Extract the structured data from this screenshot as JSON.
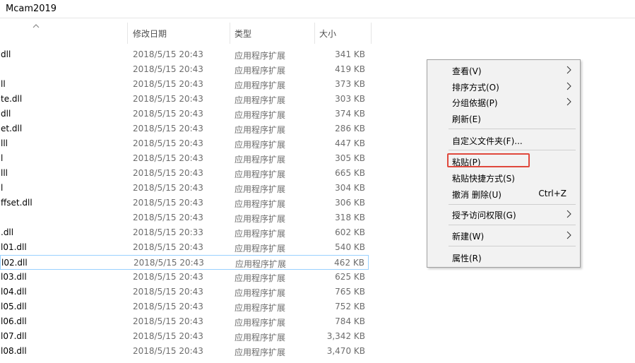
{
  "window": {
    "title": "Mcam2019"
  },
  "columns": {
    "name_sort_icon": "chevron-up",
    "date": "修改日期",
    "type": "类型",
    "size": "大小"
  },
  "files": [
    {
      "name": "dll",
      "date": "2018/5/15 20:43",
      "type": "应用程序扩展",
      "size": "341 KB"
    },
    {
      "name": "",
      "date": "2018/5/15 20:43",
      "type": "应用程序扩展",
      "size": "419 KB"
    },
    {
      "name": "ll",
      "date": "2018/5/15 20:43",
      "type": "应用程序扩展",
      "size": "373 KB"
    },
    {
      "name": "te.dll",
      "date": "2018/5/15 20:43",
      "type": "应用程序扩展",
      "size": "303 KB"
    },
    {
      "name": "dll",
      "date": "2018/5/15 20:43",
      "type": "应用程序扩展",
      "size": "374 KB"
    },
    {
      "name": "et.dll",
      "date": "2018/5/15 20:43",
      "type": "应用程序扩展",
      "size": "286 KB"
    },
    {
      "name": "lll",
      "date": "2018/5/15 20:43",
      "type": "应用程序扩展",
      "size": "447 KB"
    },
    {
      "name": "l",
      "date": "2018/5/15 20:43",
      "type": "应用程序扩展",
      "size": "305 KB"
    },
    {
      "name": "lll",
      "date": "2018/5/15 20:43",
      "type": "应用程序扩展",
      "size": "665 KB"
    },
    {
      "name": "l",
      "date": "2018/5/15 20:43",
      "type": "应用程序扩展",
      "size": "304 KB"
    },
    {
      "name": "ffset.dll",
      "date": "2018/5/15 20:43",
      "type": "应用程序扩展",
      "size": "306 KB"
    },
    {
      "name": "",
      "date": "2018/5/15 20:43",
      "type": "应用程序扩展",
      "size": "318 KB"
    },
    {
      "name": ".dll",
      "date": "2018/5/15 20:33",
      "type": "应用程序扩展",
      "size": "602 KB"
    },
    {
      "name": "l01.dll",
      "date": "2018/5/15 20:43",
      "type": "应用程序扩展",
      "size": "540 KB"
    },
    {
      "name": "l02.dll",
      "date": "2018/5/15 20:43",
      "type": "应用程序扩展",
      "size": "462 KB",
      "selected": true
    },
    {
      "name": "l03.dll",
      "date": "2018/5/15 20:43",
      "type": "应用程序扩展",
      "size": "625 KB"
    },
    {
      "name": "l04.dll",
      "date": "2018/5/15 20:43",
      "type": "应用程序扩展",
      "size": "765 KB"
    },
    {
      "name": "l05.dll",
      "date": "2018/5/15 20:43",
      "type": "应用程序扩展",
      "size": "752 KB"
    },
    {
      "name": "l06.dll",
      "date": "2018/5/15 20:43",
      "type": "应用程序扩展",
      "size": "784 KB"
    },
    {
      "name": "l07.dll",
      "date": "2018/5/15 20:43",
      "type": "应用程序扩展",
      "size": "3,342 KB"
    },
    {
      "name": "l08.dll",
      "date": "2018/5/15 20:43",
      "type": "应用程序扩展",
      "size": "3,470 KB"
    }
  ],
  "context_menu": {
    "items": [
      {
        "label": "查看(V)",
        "submenu": true
      },
      {
        "label": "排序方式(O)",
        "submenu": true
      },
      {
        "label": "分组依据(P)",
        "submenu": true
      },
      {
        "label": "刷新(E)",
        "submenu": false
      },
      {
        "label": "自定义文件夹(F)...",
        "submenu": false
      },
      {
        "label": "粘贴(P)",
        "submenu": false,
        "highlighted": true
      },
      {
        "label": "粘贴快捷方式(S)",
        "submenu": false
      },
      {
        "label": "撤消 删除(U)",
        "shortcut": "Ctrl+Z",
        "submenu": false
      },
      {
        "label": "授予访问权限(G)",
        "submenu": true
      },
      {
        "label": "新建(W)",
        "submenu": true
      },
      {
        "label": "属性(R)",
        "submenu": false
      }
    ],
    "highlight_color": "#e0483c"
  }
}
